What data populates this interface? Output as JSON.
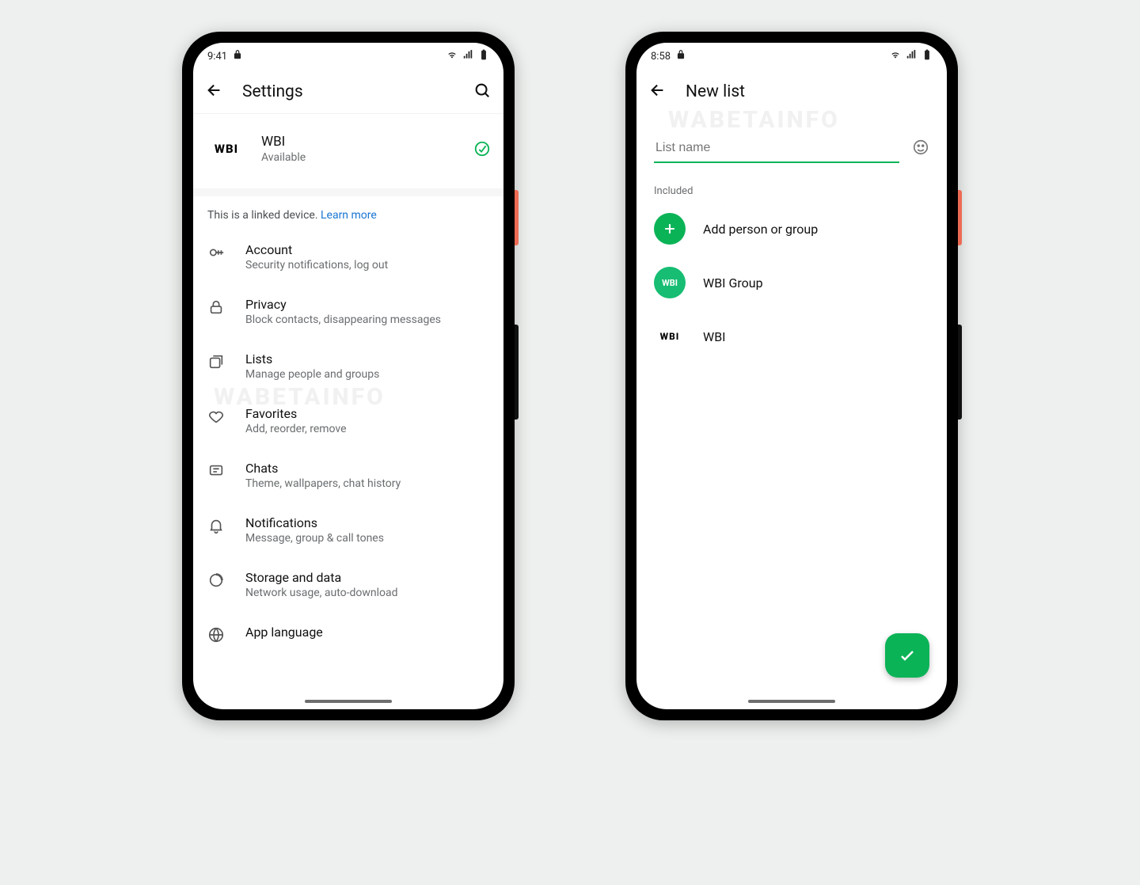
{
  "phone1": {
    "status_time": "9:41",
    "appbar_title": "Settings",
    "profile": {
      "avatar": "WBI",
      "name": "WBI",
      "status": "Available"
    },
    "linked_note_prefix": "This is a linked device. ",
    "linked_note_link": "Learn more",
    "items": [
      {
        "title": "Account",
        "sub": "Security notifications, log out"
      },
      {
        "title": "Privacy",
        "sub": "Block contacts, disappearing messages"
      },
      {
        "title": "Lists",
        "sub": "Manage people and groups"
      },
      {
        "title": "Favorites",
        "sub": "Add, reorder, remove"
      },
      {
        "title": "Chats",
        "sub": "Theme, wallpapers, chat history"
      },
      {
        "title": "Notifications",
        "sub": "Message, group & call tones"
      },
      {
        "title": "Storage and data",
        "sub": "Network usage, auto-download"
      },
      {
        "title": "App language",
        "sub": ""
      }
    ]
  },
  "phone2": {
    "status_time": "8:58",
    "appbar_title": "New list",
    "input_placeholder": "List name",
    "section_label": "Included",
    "add_label": "Add person or group",
    "group_avatar": "WBI",
    "group_label": "WBI Group",
    "contact_avatar": "WBI",
    "contact_label": "WBI"
  },
  "watermark": "WABETAINFO"
}
